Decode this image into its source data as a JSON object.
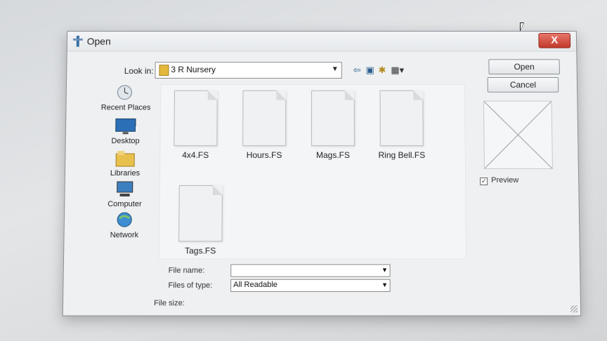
{
  "window": {
    "title": "Open",
    "close_label": "X"
  },
  "lookin": {
    "label": "Look in:",
    "value": "3 R Nursery"
  },
  "toolbar": {
    "icons": [
      "back-arrow-icon",
      "up-folder-icon",
      "new-folder-icon",
      "view-menu-icon"
    ]
  },
  "places": [
    {
      "label": "Recent Places",
      "icon": "recent-places-icon"
    },
    {
      "label": "Desktop",
      "icon": "desktop-icon"
    },
    {
      "label": "Libraries",
      "icon": "libraries-icon"
    },
    {
      "label": "Computer",
      "icon": "computer-icon"
    },
    {
      "label": "Network",
      "icon": "network-icon"
    }
  ],
  "files": [
    {
      "name": "4x4.FS"
    },
    {
      "name": "Hours.FS"
    },
    {
      "name": "Mags.FS"
    },
    {
      "name": "Ring Bell.FS"
    },
    {
      "name": "Tags.FS"
    }
  ],
  "buttons": {
    "open": "Open",
    "cancel": "Cancel"
  },
  "preview": {
    "label": "Preview",
    "checked": true,
    "check_mark": "✓"
  },
  "filename": {
    "label": "File name:",
    "value": ""
  },
  "filetype": {
    "label": "Files of type:",
    "value": "All Readable"
  },
  "filesize": {
    "label": "File size:"
  }
}
